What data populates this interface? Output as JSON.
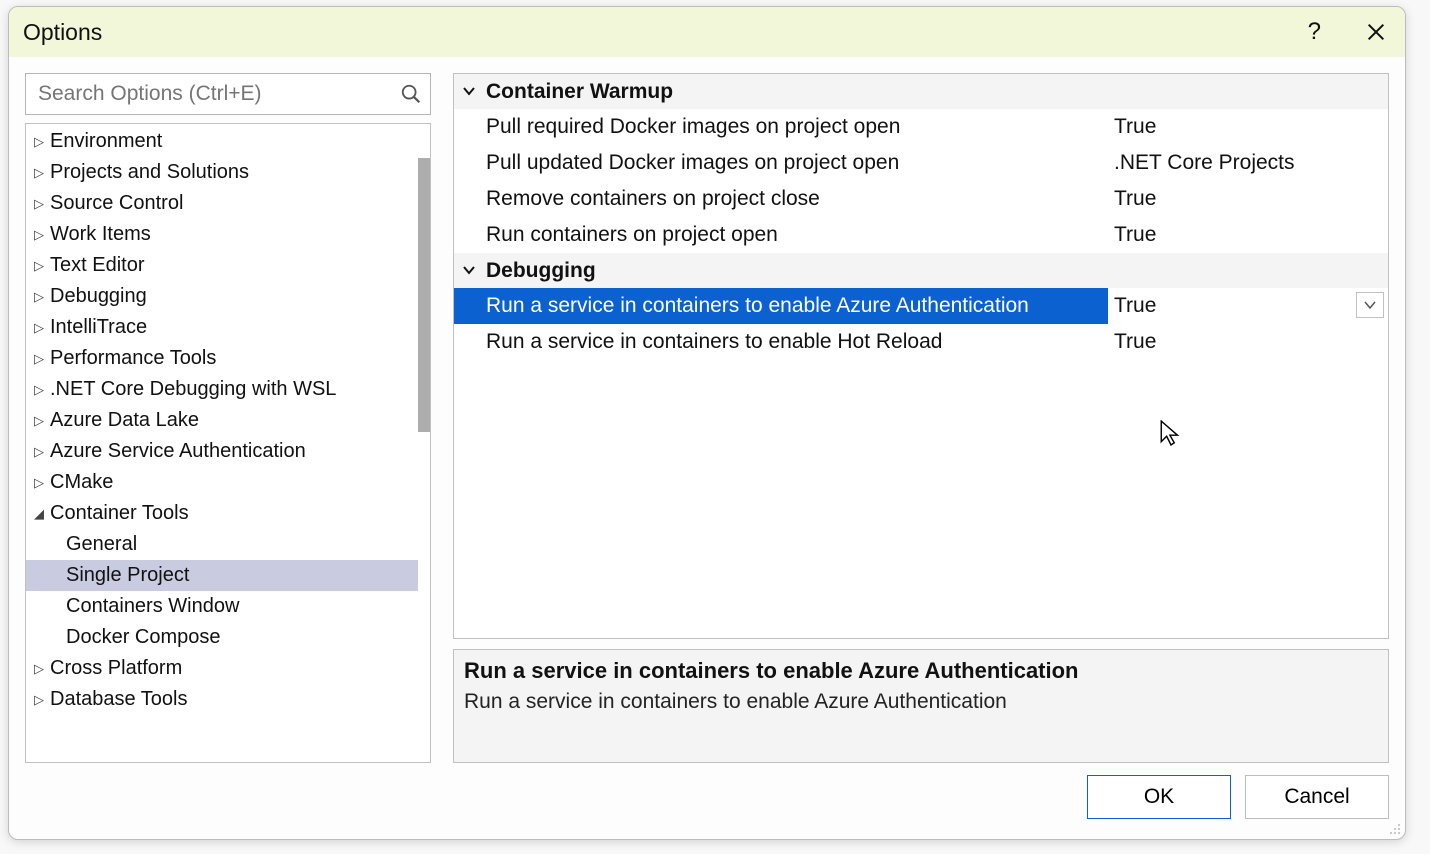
{
  "window": {
    "title": "Options"
  },
  "search": {
    "placeholder": "Search Options (Ctrl+E)"
  },
  "tree": {
    "items": [
      {
        "label": "Environment",
        "level": 1,
        "expanded": false,
        "hasChildren": true,
        "selected": false
      },
      {
        "label": "Projects and Solutions",
        "level": 1,
        "expanded": false,
        "hasChildren": true,
        "selected": false
      },
      {
        "label": "Source Control",
        "level": 1,
        "expanded": false,
        "hasChildren": true,
        "selected": false
      },
      {
        "label": "Work Items",
        "level": 1,
        "expanded": false,
        "hasChildren": true,
        "selected": false
      },
      {
        "label": "Text Editor",
        "level": 1,
        "expanded": false,
        "hasChildren": true,
        "selected": false
      },
      {
        "label": "Debugging",
        "level": 1,
        "expanded": false,
        "hasChildren": true,
        "selected": false
      },
      {
        "label": "IntelliTrace",
        "level": 1,
        "expanded": false,
        "hasChildren": true,
        "selected": false
      },
      {
        "label": "Performance Tools",
        "level": 1,
        "expanded": false,
        "hasChildren": true,
        "selected": false
      },
      {
        "label": ".NET Core Debugging with WSL",
        "level": 1,
        "expanded": false,
        "hasChildren": true,
        "selected": false
      },
      {
        "label": "Azure Data Lake",
        "level": 1,
        "expanded": false,
        "hasChildren": true,
        "selected": false
      },
      {
        "label": "Azure Service Authentication",
        "level": 1,
        "expanded": false,
        "hasChildren": true,
        "selected": false
      },
      {
        "label": "CMake",
        "level": 1,
        "expanded": false,
        "hasChildren": true,
        "selected": false
      },
      {
        "label": "Container Tools",
        "level": 1,
        "expanded": true,
        "hasChildren": true,
        "selected": false
      },
      {
        "label": "General",
        "level": 2,
        "expanded": false,
        "hasChildren": false,
        "selected": false
      },
      {
        "label": "Single Project",
        "level": 2,
        "expanded": false,
        "hasChildren": false,
        "selected": true
      },
      {
        "label": "Containers Window",
        "level": 2,
        "expanded": false,
        "hasChildren": false,
        "selected": false
      },
      {
        "label": "Docker Compose",
        "level": 2,
        "expanded": false,
        "hasChildren": false,
        "selected": false
      },
      {
        "label": "Cross Platform",
        "level": 1,
        "expanded": false,
        "hasChildren": true,
        "selected": false
      },
      {
        "label": "Database Tools",
        "level": 1,
        "expanded": false,
        "hasChildren": true,
        "selected": false
      }
    ]
  },
  "properties": {
    "categories": [
      {
        "name": "Container Warmup",
        "rows": [
          {
            "label": "Pull required Docker images on project open",
            "value": "True",
            "selected": false
          },
          {
            "label": "Pull updated Docker images on project open",
            "value": ".NET Core Projects",
            "selected": false
          },
          {
            "label": "Remove containers on project close",
            "value": "True",
            "selected": false
          },
          {
            "label": "Run containers on project open",
            "value": "True",
            "selected": false
          }
        ]
      },
      {
        "name": "Debugging",
        "rows": [
          {
            "label": "Run a service in containers to enable Azure Authentication",
            "value": "True",
            "selected": true
          },
          {
            "label": "Run a service in containers to enable Hot Reload",
            "value": "True",
            "selected": false
          }
        ]
      }
    ]
  },
  "description": {
    "title": "Run a service in containers to enable Azure Authentication",
    "body": "Run a service in containers to enable Azure Authentication"
  },
  "buttons": {
    "ok": "OK",
    "cancel": "Cancel"
  },
  "help": "?"
}
